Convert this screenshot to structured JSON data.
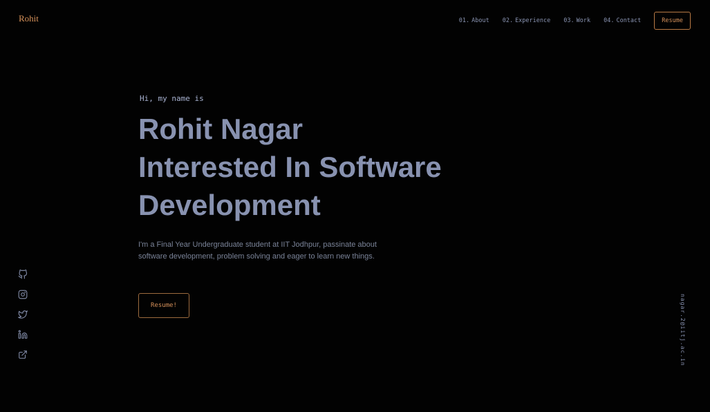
{
  "header": {
    "logo": "Rohit",
    "nav": [
      {
        "num": "01.",
        "label": "About"
      },
      {
        "num": "02.",
        "label": "Experience"
      },
      {
        "num": "03.",
        "label": "Work"
      },
      {
        "num": "04.",
        "label": "Contact"
      }
    ],
    "resume_label": "Resume"
  },
  "hero": {
    "greeting": "Hi, my name is",
    "name": "Rohit Nagar",
    "line2": "Interested In Software",
    "line3": "Development",
    "bio": "I'm a Final Year Undergraduate student at IIT Jodhpur, passinate about software development, problem solving and eager to learn new things.",
    "button": "Resume!"
  },
  "social": [
    "github-icon",
    "instagram-icon",
    "twitter-icon",
    "linkedin-icon",
    "external-link-icon"
  ],
  "email": "nagar.2@iitj.ac.in",
  "colors": {
    "background": "#020202",
    "accent": "#d6915a",
    "text": "#8892b0"
  }
}
